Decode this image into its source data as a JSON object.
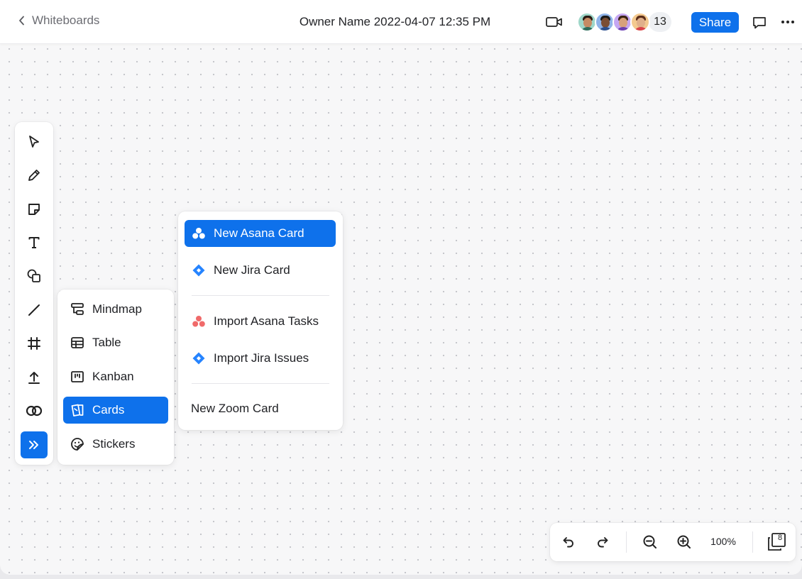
{
  "header": {
    "back_label": "Whiteboards",
    "title": "Owner Name 2022-04-07 12:35 PM",
    "participant_count": "13",
    "share_label": "Share",
    "avatars": [
      {
        "bg": "#9fd7c9",
        "skin": "#c68a63",
        "hair": "#2a1b14",
        "shirt": "#2f6b5a"
      },
      {
        "bg": "#8fb3e8",
        "skin": "#7a4d34",
        "hair": "#1a1a1a",
        "shirt": "#2c4f8c"
      },
      {
        "bg": "#c5a6f2",
        "skin": "#d7a17b",
        "hair": "#3a2414",
        "shirt": "#6a3fb0"
      },
      {
        "bg": "#f3c98f",
        "skin": "#e0b08b",
        "hair": "#5a2d1a",
        "shirt": "#d9434a"
      }
    ]
  },
  "toolbar": {
    "tools": [
      "select-icon",
      "pen-icon",
      "sticky-note-icon",
      "text-icon",
      "shapes-icon",
      "line-icon",
      "frame-icon",
      "upload-icon",
      "connector-icon",
      "more-tools-icon"
    ]
  },
  "submenu": {
    "items": [
      {
        "label": "Mindmap",
        "icon": "mindmap-icon"
      },
      {
        "label": "Table",
        "icon": "table-icon"
      },
      {
        "label": "Kanban",
        "icon": "kanban-icon"
      },
      {
        "label": "Cards",
        "icon": "cards-icon",
        "active": true
      },
      {
        "label": "Stickers",
        "icon": "stickers-icon"
      }
    ]
  },
  "cardmenu": {
    "items": [
      {
        "label": "New Asana Card",
        "icon": "asana-icon",
        "active": true
      },
      {
        "label": "New Jira Card",
        "icon": "jira-icon"
      },
      {
        "label": "Import Asana Tasks",
        "icon": "asana-icon"
      },
      {
        "label": "Import Jira Issues",
        "icon": "jira-icon"
      },
      {
        "label": "New Zoom Card",
        "icon": ""
      }
    ]
  },
  "bottombar": {
    "zoom_level": "100%",
    "page_count": "8"
  },
  "colors": {
    "accent": "#0e71eb",
    "asana": "#f06a6a",
    "jira": "#2684ff"
  }
}
